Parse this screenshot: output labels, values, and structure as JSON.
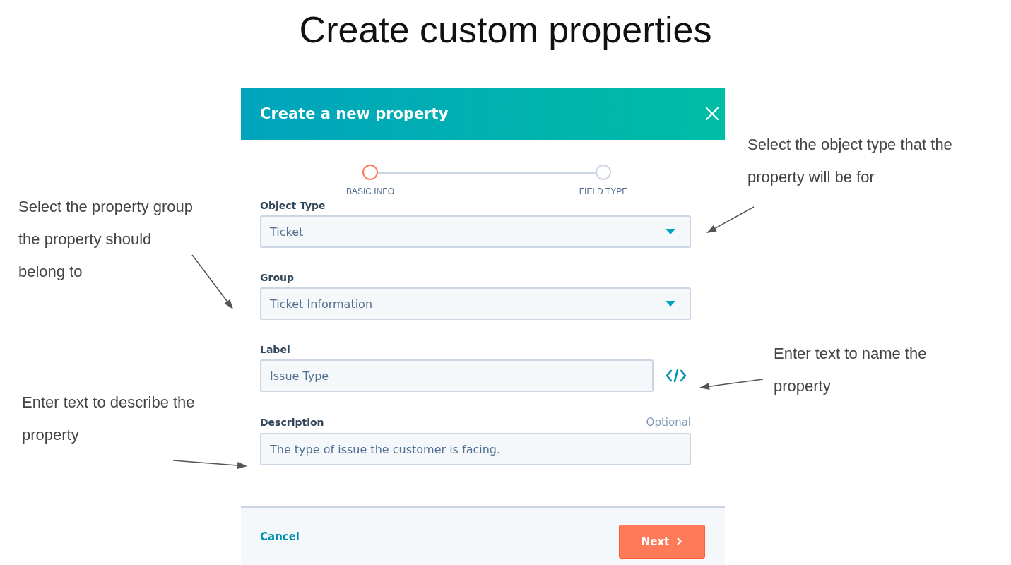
{
  "slide_title": "Create custom properties",
  "dialog": {
    "title": "Create a new property",
    "steps": [
      {
        "label": "BASIC INFO",
        "selected": true
      },
      {
        "label": "FIELD TYPE",
        "selected": false
      }
    ],
    "fields": [
      {
        "kind": "select",
        "label": "Object Type",
        "value": "Ticket"
      },
      {
        "kind": "select",
        "label": "Group",
        "value": "Ticket Information"
      },
      {
        "kind": "text_code",
        "label": "Label",
        "value": "Issue Type"
      },
      {
        "kind": "text",
        "label": "Description",
        "hint": "Optional",
        "value": "The type of issue the customer is facing."
      }
    ],
    "cancel": "Cancel",
    "next": "Next"
  },
  "annotations": [
    {
      "text": "Select the object type that the\nproperty will be for"
    },
    {
      "text": "Select the property group\nthe property should\nbelong to"
    },
    {
      "text": "Enter text to name the\nproperty"
    },
    {
      "text": "Enter text to describe the\nproperty"
    }
  ]
}
